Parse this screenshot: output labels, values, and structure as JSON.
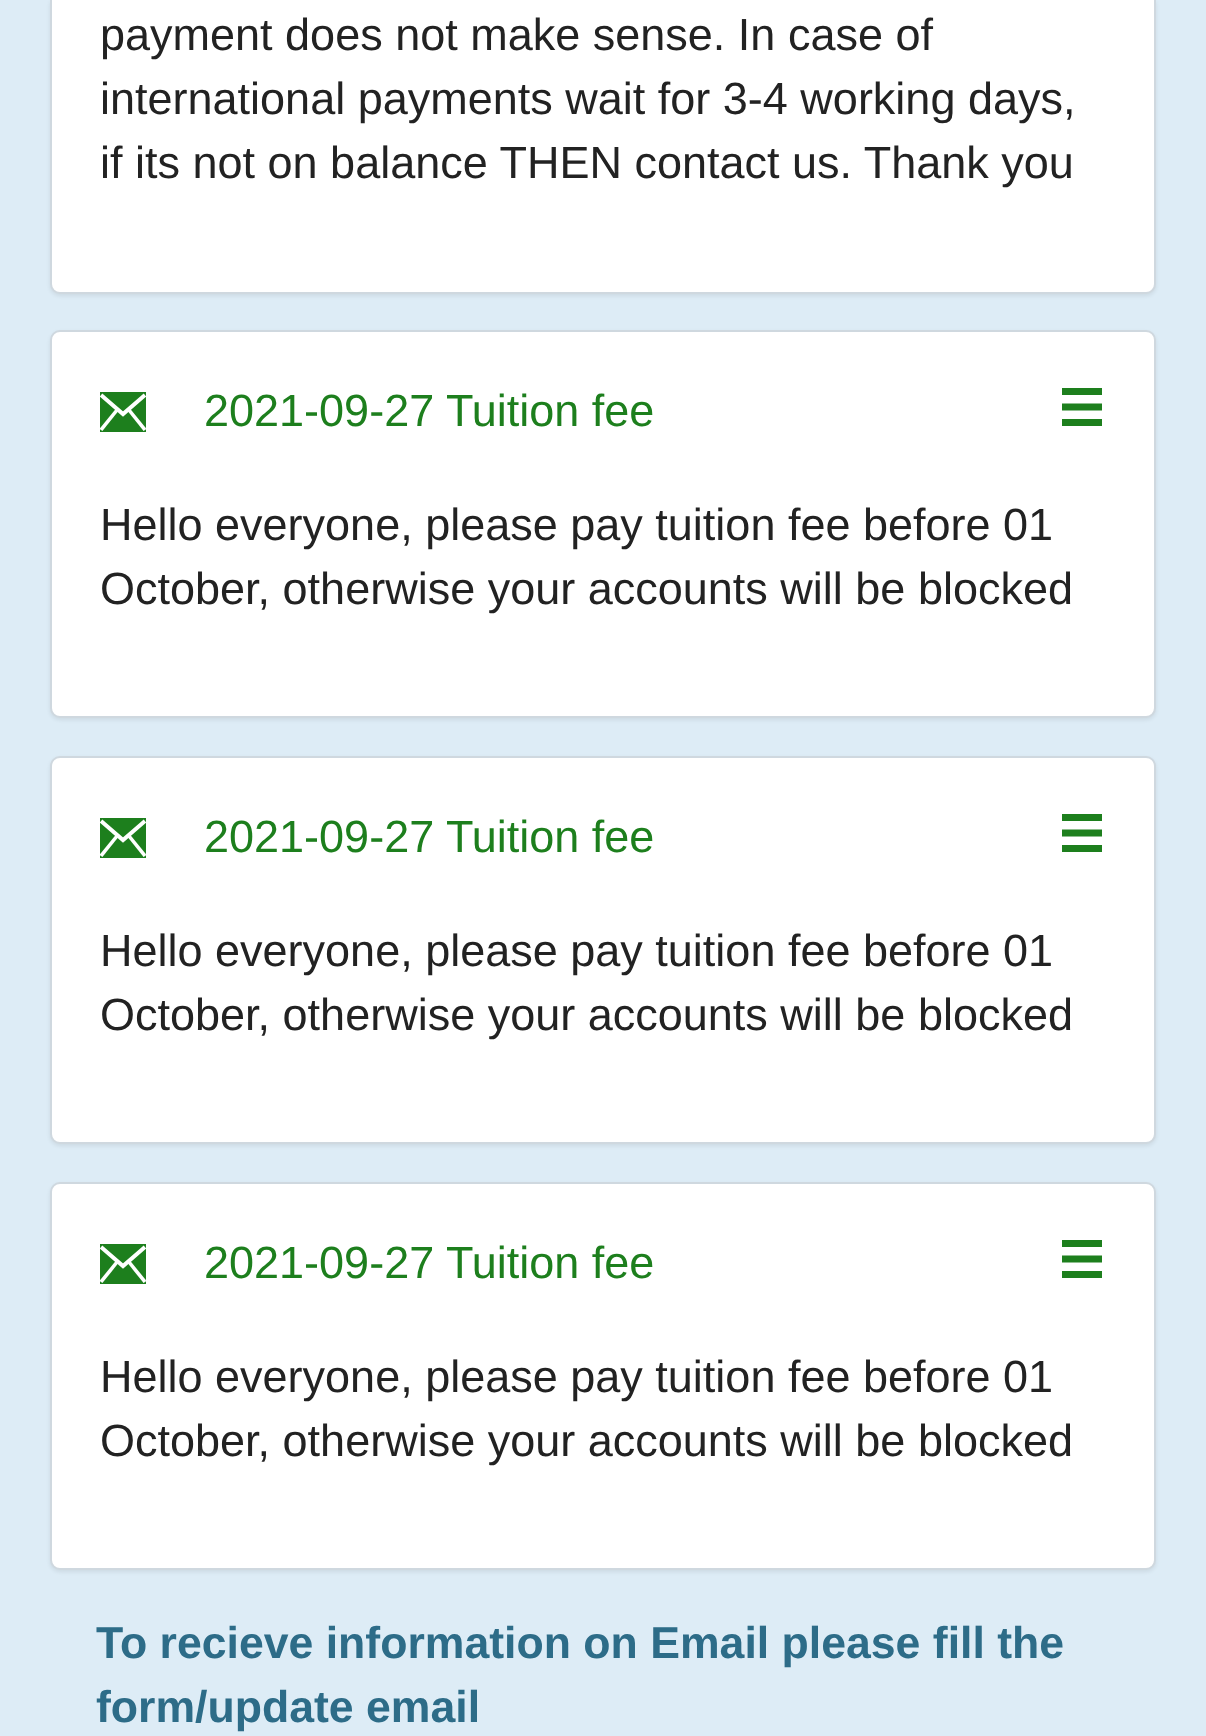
{
  "notices": [
    {
      "body": "payment does not make sense. In case of international payments wait for 3-4 working days, if its not on balance THEN contact us. Thank you"
    },
    {
      "title": "2021-09-27 Tuition fee",
      "body": "Hello everyone, please pay tuition fee before 01 October, otherwise your accounts will be blocked"
    },
    {
      "title": "2021-09-27 Tuition fee",
      "body": "Hello everyone, please pay tuition fee before 01 October, otherwise your accounts will be blocked"
    },
    {
      "title": "2021-09-27 Tuition fee",
      "body": "Hello everyone, please pay tuition fee before 01 October, otherwise your accounts will be blocked"
    }
  ],
  "footer_note": "To recieve information on Email please fill the form/update email"
}
